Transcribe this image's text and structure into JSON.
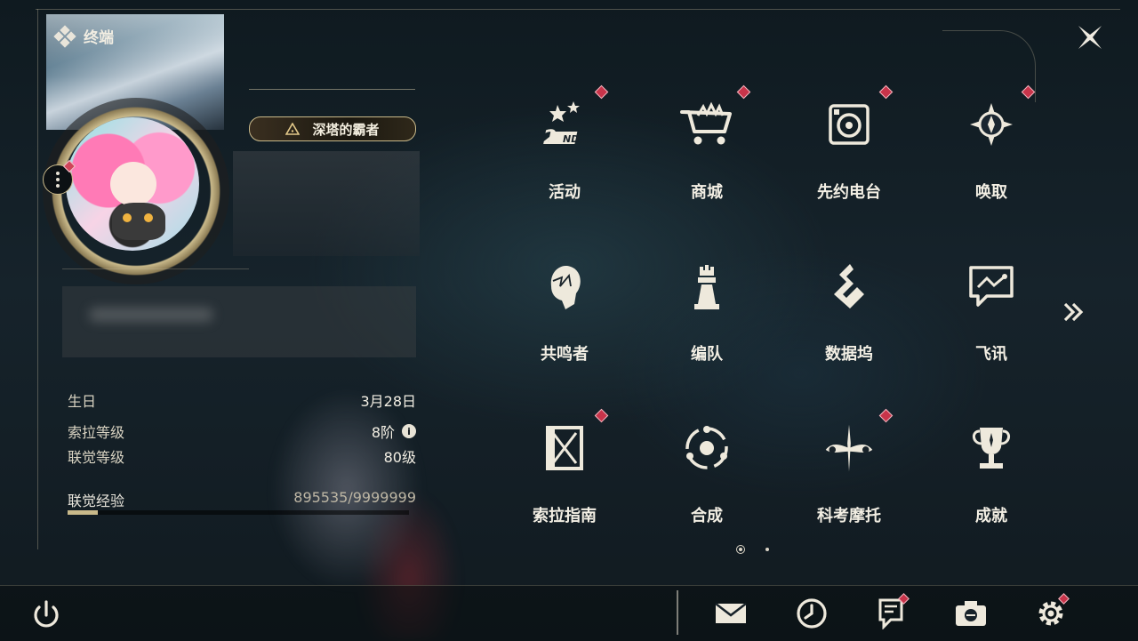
{
  "header": {
    "title": "终端"
  },
  "profile": {
    "title_badge": "深塔的霸者",
    "stats": [
      {
        "label": "生日",
        "value": "3月28日"
      },
      {
        "label": "索拉等级",
        "value": "8阶"
      },
      {
        "label": "联觉等级",
        "value": "80级"
      }
    ],
    "exp": {
      "label": "联觉经验",
      "value": "895535/9999999",
      "progress": 0.0896
    }
  },
  "menu": {
    "items": [
      {
        "label": "活动",
        "icon": "event-2nd-icon",
        "badge": true
      },
      {
        "label": "商城",
        "icon": "shop-cart-icon",
        "badge": true
      },
      {
        "label": "先约电台",
        "icon": "radio-icon",
        "badge": true
      },
      {
        "label": "唤取",
        "icon": "convene-compass-icon",
        "badge": true
      },
      {
        "label": "共鸣者",
        "icon": "resonator-head-icon",
        "badge": false
      },
      {
        "label": "编队",
        "icon": "team-chess-icon",
        "badge": false
      },
      {
        "label": "数据坞",
        "icon": "data-bank-icon",
        "badge": false
      },
      {
        "label": "飞讯",
        "icon": "message-chat-icon",
        "badge": false
      },
      {
        "label": "索拉指南",
        "icon": "guide-book-icon",
        "badge": true
      },
      {
        "label": "合成",
        "icon": "synthesis-icon",
        "badge": false
      },
      {
        "label": "科考摩托",
        "icon": "motorbike-icon",
        "badge": true
      },
      {
        "label": "成就",
        "icon": "trophy-icon",
        "badge": false
      }
    ],
    "page_current": 1,
    "page_total": 2
  },
  "bottom_bar": [
    {
      "icon": "mail-icon",
      "badge": false
    },
    {
      "icon": "clock-icon",
      "badge": false
    },
    {
      "icon": "notice-icon",
      "badge": true
    },
    {
      "icon": "camera-icon",
      "badge": false
    },
    {
      "icon": "settings-gear-icon",
      "badge": true
    }
  ],
  "colors": {
    "accent_gold": "#c9b98a",
    "badge_red": "#c8344a",
    "text": "#f3efe4"
  }
}
